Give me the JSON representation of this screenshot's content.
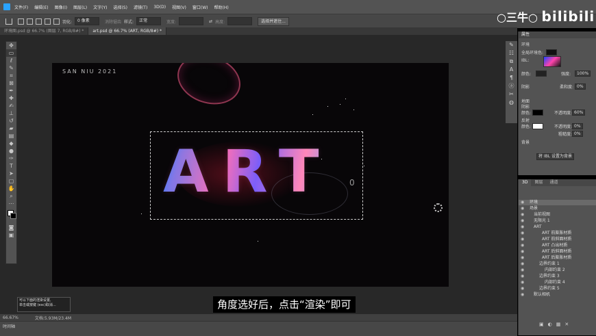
{
  "menu": [
    "文件(F)",
    "编辑(E)",
    "图像(I)",
    "图层(L)",
    "文字(Y)",
    "选择(S)",
    "滤镜(T)",
    "3D(D)",
    "视图(V)",
    "窗口(W)",
    "帮助(H)"
  ],
  "options": {
    "feather_label": "羽化:",
    "feather_value": "0 像素",
    "smooth_label": "消除锯齿",
    "style_label": "样式:",
    "style_value": "正常",
    "width_label": "宽度:",
    "height_label": "高度:",
    "mask_button": "选择并遮住..."
  },
  "tabs": [
    {
      "label": "环境图.psd @ 66.7% (图层 7, RGB/8#) *"
    },
    {
      "label": "art.psd @ 66.7% (ART, RGB/8#) *"
    }
  ],
  "canvas": {
    "signature": "SAN NIU 2021",
    "art_text": "ART",
    "cursor_char": "0"
  },
  "hint": {
    "line1": "可以下面的渲染设置,",
    "line2": "单击或按键 (esc)取消..."
  },
  "subtitle": "角度选好后，点击“渲染”即可",
  "status": {
    "zoom": "66.67%",
    "doc": "文档:5.93M/23.4M"
  },
  "timeline_label": "时间轴",
  "watermark": {
    "prefix": "○三牛○",
    "brand": "bilibili"
  },
  "properties": {
    "title": "属性",
    "env_label": "环境",
    "global_light": "全局环境色:",
    "ibl": "IBL:",
    "color_label": "颜色:",
    "intensity_label": "强度:",
    "intensity_value": "100%",
    "shadow_label": "阴影",
    "softness_label": "柔和度:",
    "softness_value": "0%",
    "ground_label": "地面",
    "ground_shadow": "阴影",
    "ground_color": "颜色:",
    "opacity_label": "不透明度:",
    "opacity_value": "60%",
    "reflect_label": "反射",
    "reflect_color": "颜色:",
    "reflect_opacity_label": "不透明度:",
    "reflect_opacity_value": "0%",
    "roughness_label": "粗糙度:",
    "roughness_value": "0%",
    "bg_label": "背景",
    "bg_button": "将 IBL 设置为背景"
  },
  "layers": {
    "tabs": [
      "3D",
      "图层",
      "通道"
    ],
    "rows": [
      "环境",
      "场景",
      "当前视图",
      "无限光 1",
      "ART",
      "ART 前膨胀材质",
      "ART 前斜面材质",
      "ART 凸出材质",
      "ART 后斜面材质",
      "ART 后膨胀材质",
      "边界约束 1",
      "内部约束 2",
      "边界约束 3",
      "内部约束 4",
      "边界约束 5",
      "默认相机"
    ]
  }
}
